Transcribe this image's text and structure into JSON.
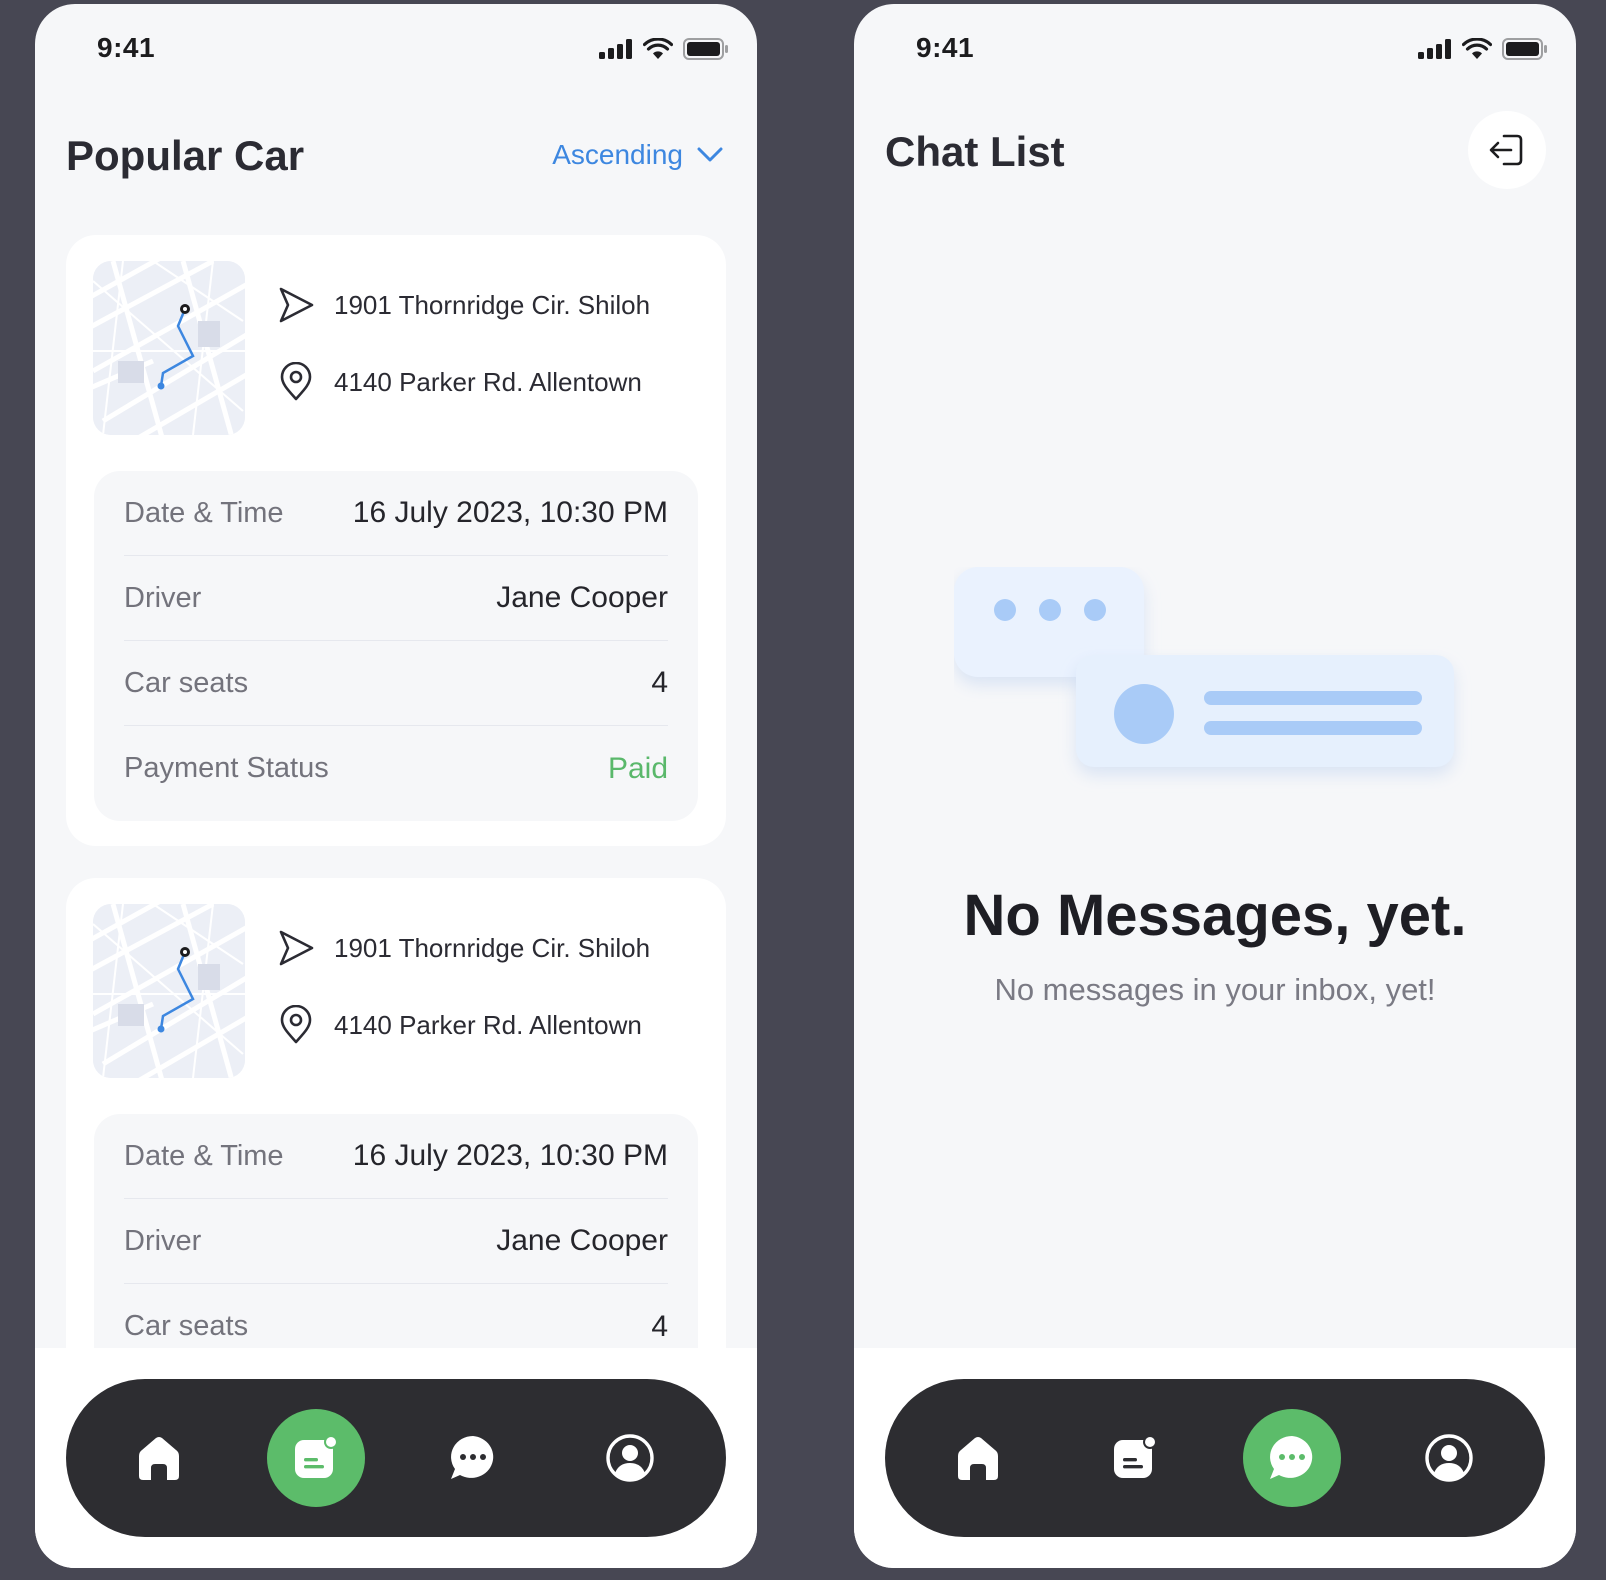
{
  "status_bar": {
    "time": "9:41"
  },
  "popular_screen": {
    "title": "Popular Car",
    "sort": {
      "label": "Ascending"
    },
    "trips": [
      {
        "from": "1901 Thornridge Cir. Shiloh",
        "to": "4140 Parker Rd. Allentown",
        "details": [
          {
            "label": "Date & Time",
            "value": "16 July 2023, 10:30 PM"
          },
          {
            "label": "Driver",
            "value": "Jane Cooper"
          },
          {
            "label": "Car seats",
            "value": "4"
          },
          {
            "label": "Payment Status",
            "value": "Paid"
          }
        ]
      },
      {
        "from": "1901 Thornridge Cir. Shiloh",
        "to": "4140 Parker Rd. Allentown",
        "details": [
          {
            "label": "Date & Time",
            "value": "16 July 2023, 10:30 PM"
          },
          {
            "label": "Driver",
            "value": "Jane Cooper"
          },
          {
            "label": "Car seats",
            "value": "4"
          }
        ]
      }
    ]
  },
  "chat_screen": {
    "title": "Chat List",
    "empty_title": "No Messages, yet.",
    "empty_subtitle": "No messages in your inbox, yet!"
  },
  "nav": {
    "items": [
      "home-icon",
      "orders-icon",
      "chat-icon",
      "profile-icon"
    ],
    "left_active": "orders-icon",
    "right_active": "chat-icon"
  },
  "colors": {
    "accent_blue": "#3d87e0",
    "active_green": "#5cbc6a",
    "paid_green": "#5ab86b",
    "nav_dark": "#2d2d31"
  }
}
